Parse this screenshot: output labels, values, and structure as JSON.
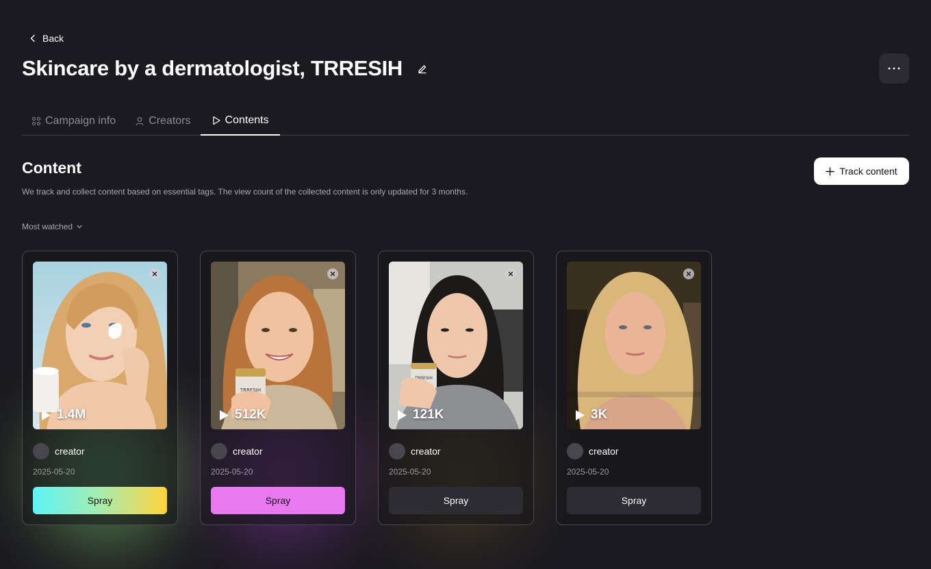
{
  "nav": {
    "back_label": "Back"
  },
  "campaign": {
    "title": "Skincare by a dermatologist, TRRESIH"
  },
  "tabs": [
    {
      "label": "Campaign info",
      "icon": "campaign-icon"
    },
    {
      "label": "Creators",
      "icon": "user-icon"
    },
    {
      "label": "Contents",
      "icon": "play-icon",
      "active": true
    }
  ],
  "content": {
    "title": "Content",
    "description": "We track and collect content based on essential tags. The view count of the collected content is only updated for 3 months.",
    "track_button_label": "Track content",
    "sort_label": "Most watched"
  },
  "cards": [
    {
      "views": "1.4M",
      "creator": "creator",
      "date": "2025-05-20",
      "action_label": "Spray",
      "button_style": "gradient cyan-green-yellow",
      "glow_color": "#4fd6c8"
    },
    {
      "views": "512K",
      "creator": "creator",
      "date": "2025-05-20",
      "action_label": "Spray",
      "button_style": "solid",
      "button_color": "#e879f0",
      "glow_color": "#b347c9"
    },
    {
      "views": "121K",
      "creator": "creator",
      "date": "2025-05-20",
      "action_label": "Spray",
      "button_style": "dark",
      "button_color": "#2d2c32",
      "glow_color": "#9c7a2a"
    },
    {
      "views": "3K",
      "creator": "creator",
      "date": "2025-05-20",
      "action_label": "Spray",
      "button_style": "dark",
      "button_color": "#2d2c32"
    }
  ]
}
